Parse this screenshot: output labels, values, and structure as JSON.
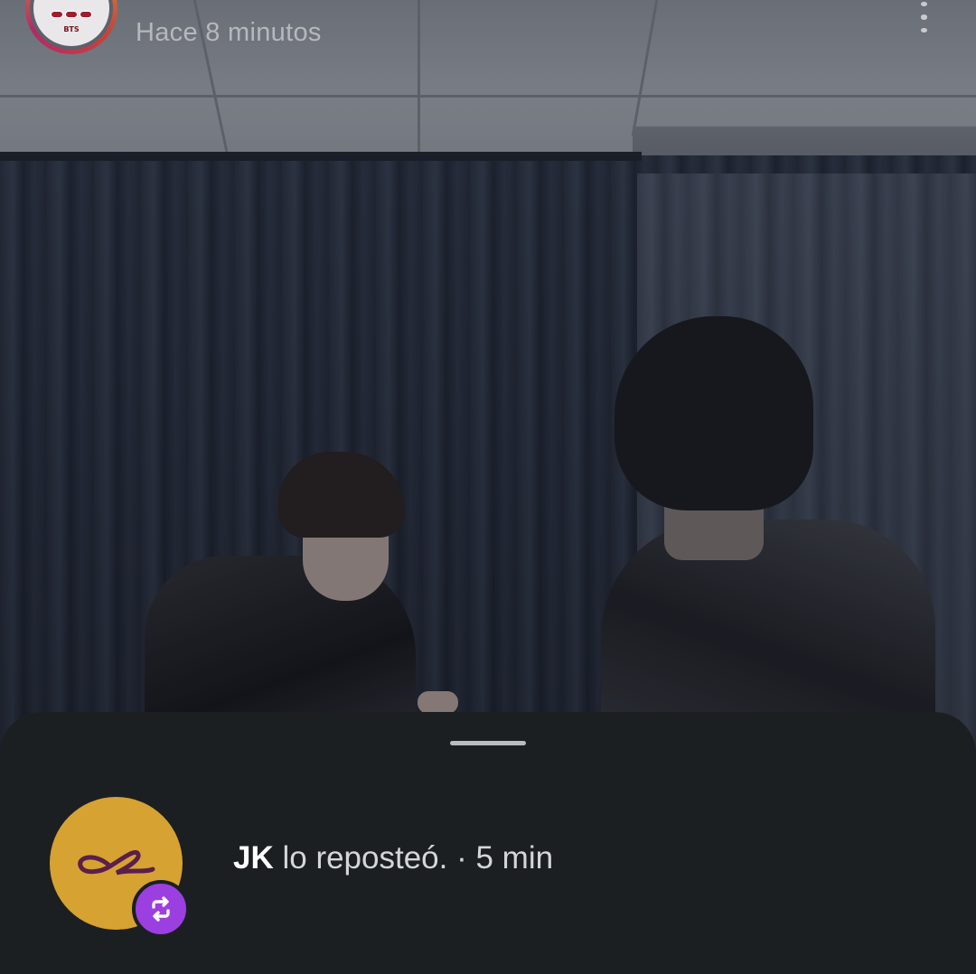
{
  "header": {
    "post_time": "Hace 8 minutos",
    "avatar_label": "BTS",
    "more_icon": "more-vertical-icon"
  },
  "repost": {
    "username": "JK",
    "action_text": " lo reposteó.",
    "separator": " · ",
    "time": "5 min",
    "badge_icon": "repost-icon",
    "avatar_color": "#d6a232",
    "badge_color": "#9b3fe0"
  },
  "colors": {
    "sheet_background": "#1c1f22",
    "time_text": "#b6b8bc"
  }
}
